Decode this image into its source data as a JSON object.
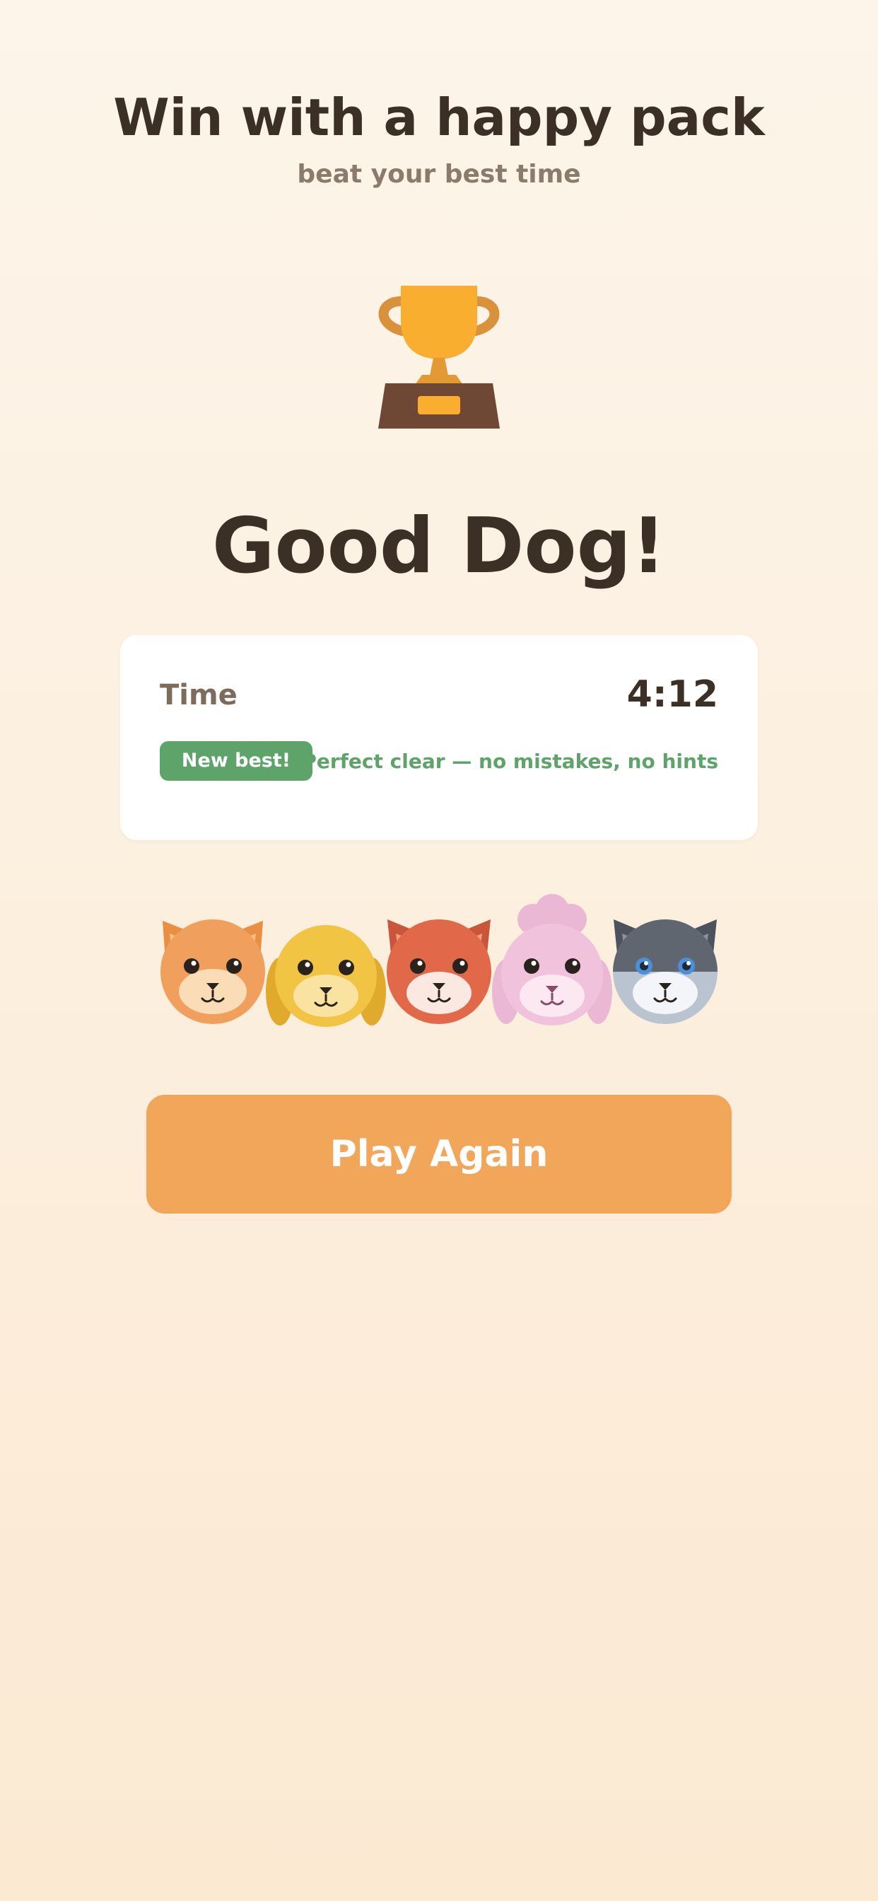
{
  "header": {
    "headline": "Win with a happy pack",
    "subheadline": "beat your best time"
  },
  "result": {
    "title": "Good Dog!",
    "icon": "trophy-icon"
  },
  "stats": {
    "time_label": "Time",
    "time_value": "4:12",
    "best_badge": "New best!",
    "perfect_text": "Perfect clear — no mistakes, no hints"
  },
  "pack": [
    {
      "name": "orange-pup",
      "color": "#f0a05c"
    },
    {
      "name": "golden-pup",
      "color": "#f2c443"
    },
    {
      "name": "red-pup",
      "color": "#e2684a"
    },
    {
      "name": "pink-pup",
      "color": "#f0c2dc"
    },
    {
      "name": "grey-pup",
      "color": "#5f6670"
    }
  ],
  "actions": {
    "play_again_label": "Play Again"
  },
  "colors": {
    "accent": "#f2a65a",
    "success": "#5da36a",
    "text_dark": "#3b2f26",
    "trophy_gold": "#f9ae2f",
    "trophy_base": "#6e4735"
  }
}
